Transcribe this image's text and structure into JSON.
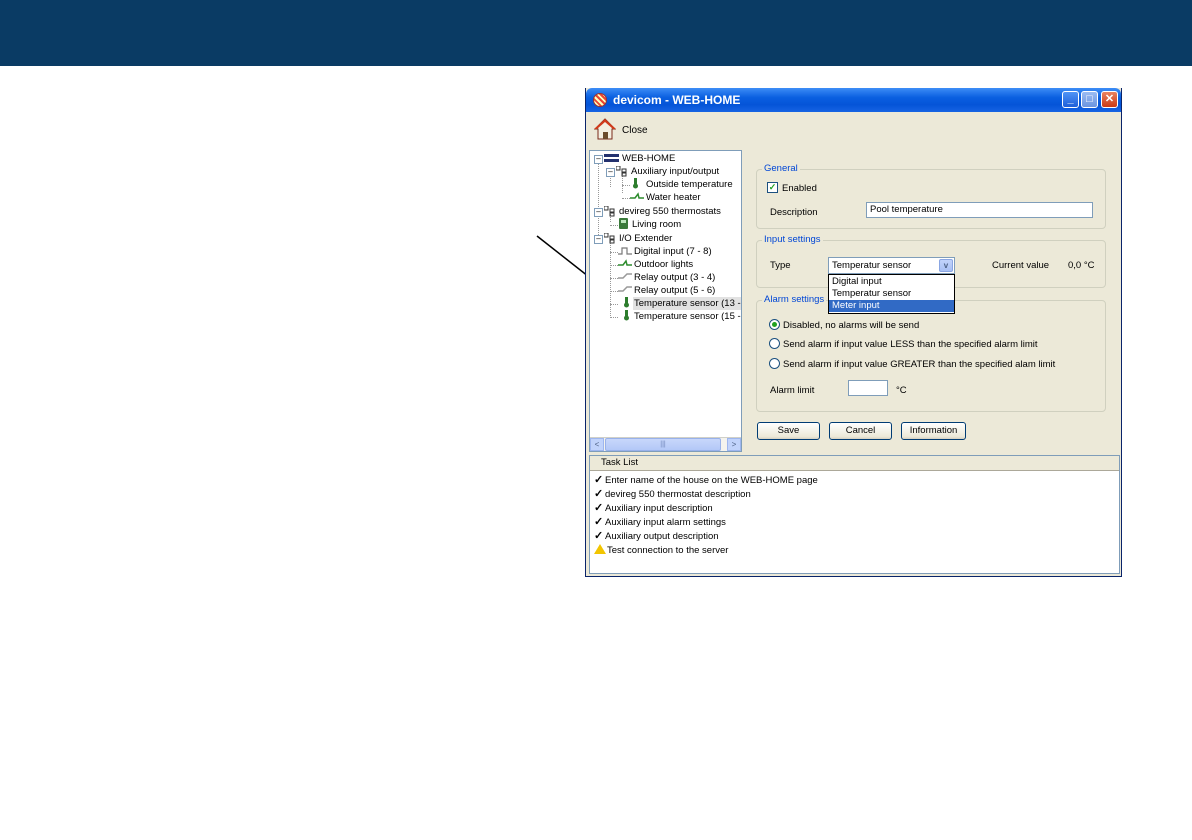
{
  "window": {
    "title": "devicom - WEB-HOME",
    "minimize": "_",
    "maximize": "□",
    "close": "✕"
  },
  "toolbar": {
    "close_label": "Close"
  },
  "tree": {
    "root": "WEB-HOME",
    "aux_group": "Auxiliary input/output",
    "outside_temp": "Outside temperature",
    "water_heater": "Water heater",
    "thermo_group": "devireg 550 thermostats",
    "living_room": "Living room",
    "io_group": "I/O Extender",
    "digital_input": "Digital input (7 - 8)",
    "outdoor_lights": "Outdoor lights",
    "relay_34": "Relay output (3 - 4)",
    "relay_56": "Relay output (5 - 6)",
    "temp_13": "Temperature sensor (13 -",
    "temp_15": "Temperature sensor (15 -",
    "scroll_left": "<",
    "scroll_right": ">",
    "scroll_grip": "|||"
  },
  "general": {
    "title": "General",
    "enabled_label": "Enabled",
    "enabled_mark": "✓",
    "description_label": "Description",
    "description_value": "Pool temperature"
  },
  "input_settings": {
    "title": "Input settings",
    "type_label": "Type",
    "type_selected": "Temperatur sensor",
    "type_arrow": "v",
    "options": [
      "Digital input",
      "Temperatur sensor",
      "Meter input"
    ],
    "current_value_label": "Current value",
    "current_value": "0,0 °C"
  },
  "alarm_settings": {
    "title": "Alarm settings",
    "opt_disabled": "Disabled, no alarms will be send",
    "opt_less": "Send alarm if input value LESS than the specified alarm limit",
    "opt_greater": "Send alarm if input value GREATER than the specified alam limit",
    "alarm_limit_label": "Alarm limit",
    "alarm_limit_value": "",
    "alarm_limit_unit": "°C"
  },
  "buttons": {
    "save": "Save",
    "cancel": "Cancel",
    "information": "Information"
  },
  "task_list": {
    "header": "Task List",
    "items": [
      "Enter name of the house on the WEB-HOME page",
      "devireg 550 thermostat description",
      "Auxiliary input description",
      "Auxiliary input alarm settings",
      "Auxiliary output description",
      "Test connection to the server"
    ],
    "check": "✓"
  },
  "colors": {
    "banner": "#0a3b64",
    "window_face": "#ece9d8",
    "titlebar": "#0554d8",
    "group_title": "#0046d5",
    "selection": "#316ac5"
  }
}
